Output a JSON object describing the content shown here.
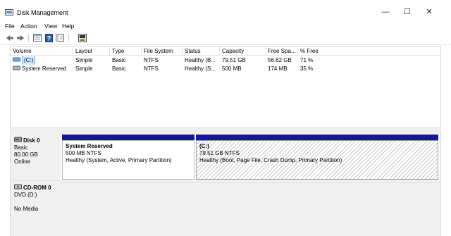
{
  "window": {
    "title": "Disk Management",
    "minimize_glyph": "—",
    "maximize_glyph": "☐",
    "close_glyph": "✕"
  },
  "menu": [
    "File",
    "Action",
    "View",
    "Help"
  ],
  "toolbar": {
    "icons": [
      "back-arrow-icon",
      "forward-arrow-icon",
      "properties-icon",
      "help-icon",
      "show-hide-pane-icon",
      "settings-icon"
    ]
  },
  "volumes": {
    "columns": [
      "Volume",
      "Layout",
      "Type",
      "File System",
      "Status",
      "Capacity",
      "Free Spa...",
      "% Free"
    ],
    "rows": [
      {
        "volume": "(C:)",
        "layout": "Simple",
        "type": "Basic",
        "fs": "NTFS",
        "status": "Healthy (B...",
        "capacity": "79.51 GB",
        "free": "56.62 GB",
        "pct": "71 %"
      },
      {
        "volume": "System Reserved",
        "layout": "Simple",
        "type": "Basic",
        "fs": "NTFS",
        "status": "Healthy (S...",
        "capacity": "500 MB",
        "free": "174 MB",
        "pct": "35 %"
      }
    ]
  },
  "disk0": {
    "name": "Disk 0",
    "type": "Basic",
    "size": "80.00 GB",
    "state": "Online",
    "partitions": [
      {
        "title": "System Reserved",
        "size": "500 MB NTFS",
        "status": "Healthy (System, Active, Primary Partition)"
      },
      {
        "title": "(C:)",
        "size": "79.51 GB NTFS",
        "status": "Healthy (Boot, Page File, Crash Dump, Primary Partition)"
      }
    ],
    "colors": {
      "primary_bar": "#16159b",
      "selected_hatch": "#c9c9c9"
    }
  },
  "cdrom": {
    "name": "CD-ROM 0",
    "drive": "DVD (D:)",
    "media": "No Media"
  }
}
